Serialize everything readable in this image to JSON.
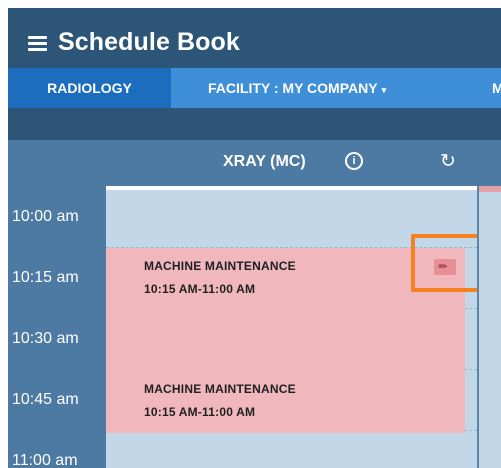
{
  "app": {
    "title": "Schedule Book",
    "menu_icon": "hamburger-menu-icon"
  },
  "tabs": {
    "radiology": "RADIOLOGY",
    "facility": "FACILITY : MY COMPANY",
    "facility_caret": "▾",
    "more": "M"
  },
  "column": {
    "title": "XRAY (MC)",
    "info_icon": "info-icon",
    "refresh_icon": "refresh-icon"
  },
  "times": [
    "10:00 am",
    "10:15 am",
    "10:30 am",
    "10:45 am",
    "11:00 am"
  ],
  "event": {
    "title": "MACHINE MAINTENANCE",
    "time_range": "10:15 AM-11:00 AM",
    "edit_icon": "pencil-edit-icon"
  },
  "colors": {
    "title_bar": "#2d5577",
    "tab_bar": "#3f8ed8",
    "active_tab": "#1d6dbf",
    "grid": "#c2d7e8",
    "event": "#f0b7bd",
    "highlight": "#f5821f"
  }
}
